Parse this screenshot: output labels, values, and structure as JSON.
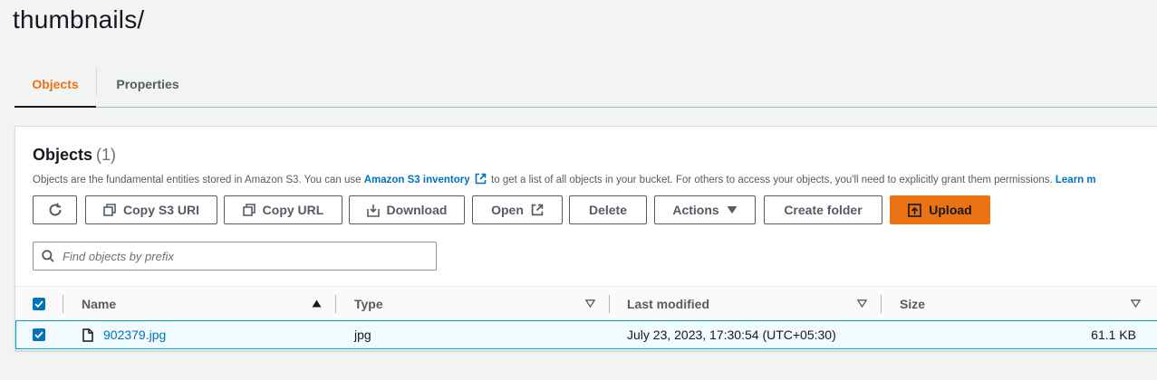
{
  "page": {
    "title": "thumbnails/"
  },
  "tabs": [
    {
      "label": "Objects",
      "active": true
    },
    {
      "label": "Properties",
      "active": false
    }
  ],
  "panel": {
    "title": "Objects",
    "count": "(1)",
    "desc_before": "Objects are the fundamental entities stored in Amazon S3. You can use ",
    "desc_link": "Amazon S3 inventory",
    "desc_after": " to get a list of all objects in your bucket. For others to access your objects, you'll need to explicitly grant them permissions. ",
    "desc_learn": "Learn m"
  },
  "toolbar": {
    "refresh_icon": "refresh-icon",
    "copy_s3_uri": "Copy S3 URI",
    "copy_url": "Copy URL",
    "download": "Download",
    "open": "Open",
    "delete": "Delete",
    "actions": "Actions",
    "create_folder": "Create folder",
    "upload": "Upload"
  },
  "search": {
    "placeholder": "Find objects by prefix",
    "value": ""
  },
  "table": {
    "columns": [
      "Name",
      "Type",
      "Last modified",
      "Size"
    ],
    "rows": [
      {
        "selected": true,
        "name": "902379.jpg",
        "type": "jpg",
        "last_modified": "July 23, 2023, 17:30:54 (UTC+05:30)",
        "size": "61.1 KB"
      }
    ]
  },
  "colors": {
    "accent": "#ec7211",
    "link": "#0073bb",
    "selected_row_bg": "#f1faff",
    "selected_row_border": "#00a1c9"
  }
}
